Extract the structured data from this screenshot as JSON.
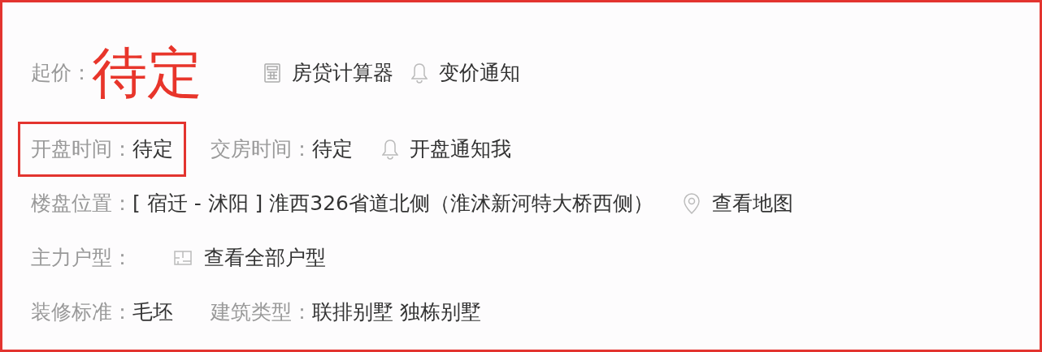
{
  "rows": [
    {
      "items": [
        {
          "kind": "price",
          "label": "起价：",
          "value": "待定",
          "highlighted": false
        },
        {
          "kind": "calculator",
          "text": "房贷计算器"
        },
        {
          "kind": "bell",
          "text": "变价通知"
        }
      ]
    },
    {
      "items": [
        {
          "kind": "field",
          "label": "开盘时间：",
          "value": "待定",
          "highlighted": true
        },
        {
          "kind": "field",
          "label": "交房时间：",
          "value": "待定",
          "highlighted": false
        },
        {
          "kind": "bell",
          "text": "开盘通知我"
        }
      ]
    },
    {
      "items": [
        {
          "kind": "field",
          "label": "楼盘位置：",
          "value": "[ 宿迁 - 沭阳 ] 淮西326省道北侧（淮沭新河特大桥西侧）",
          "highlighted": false
        },
        {
          "kind": "pin",
          "text": "查看地图"
        }
      ]
    },
    {
      "items": [
        {
          "kind": "field",
          "label": "主力户型：",
          "highlighted": false
        },
        {
          "kind": "floorplan",
          "text": "查看全部户型"
        }
      ]
    },
    {
      "items": [
        {
          "kind": "field",
          "label": "装修标准：",
          "value": "毛坯",
          "highlighted": false
        },
        {
          "kind": "field",
          "label": "建筑类型：",
          "value": "联排别墅 独栋别墅",
          "highlighted": false
        }
      ]
    }
  ]
}
